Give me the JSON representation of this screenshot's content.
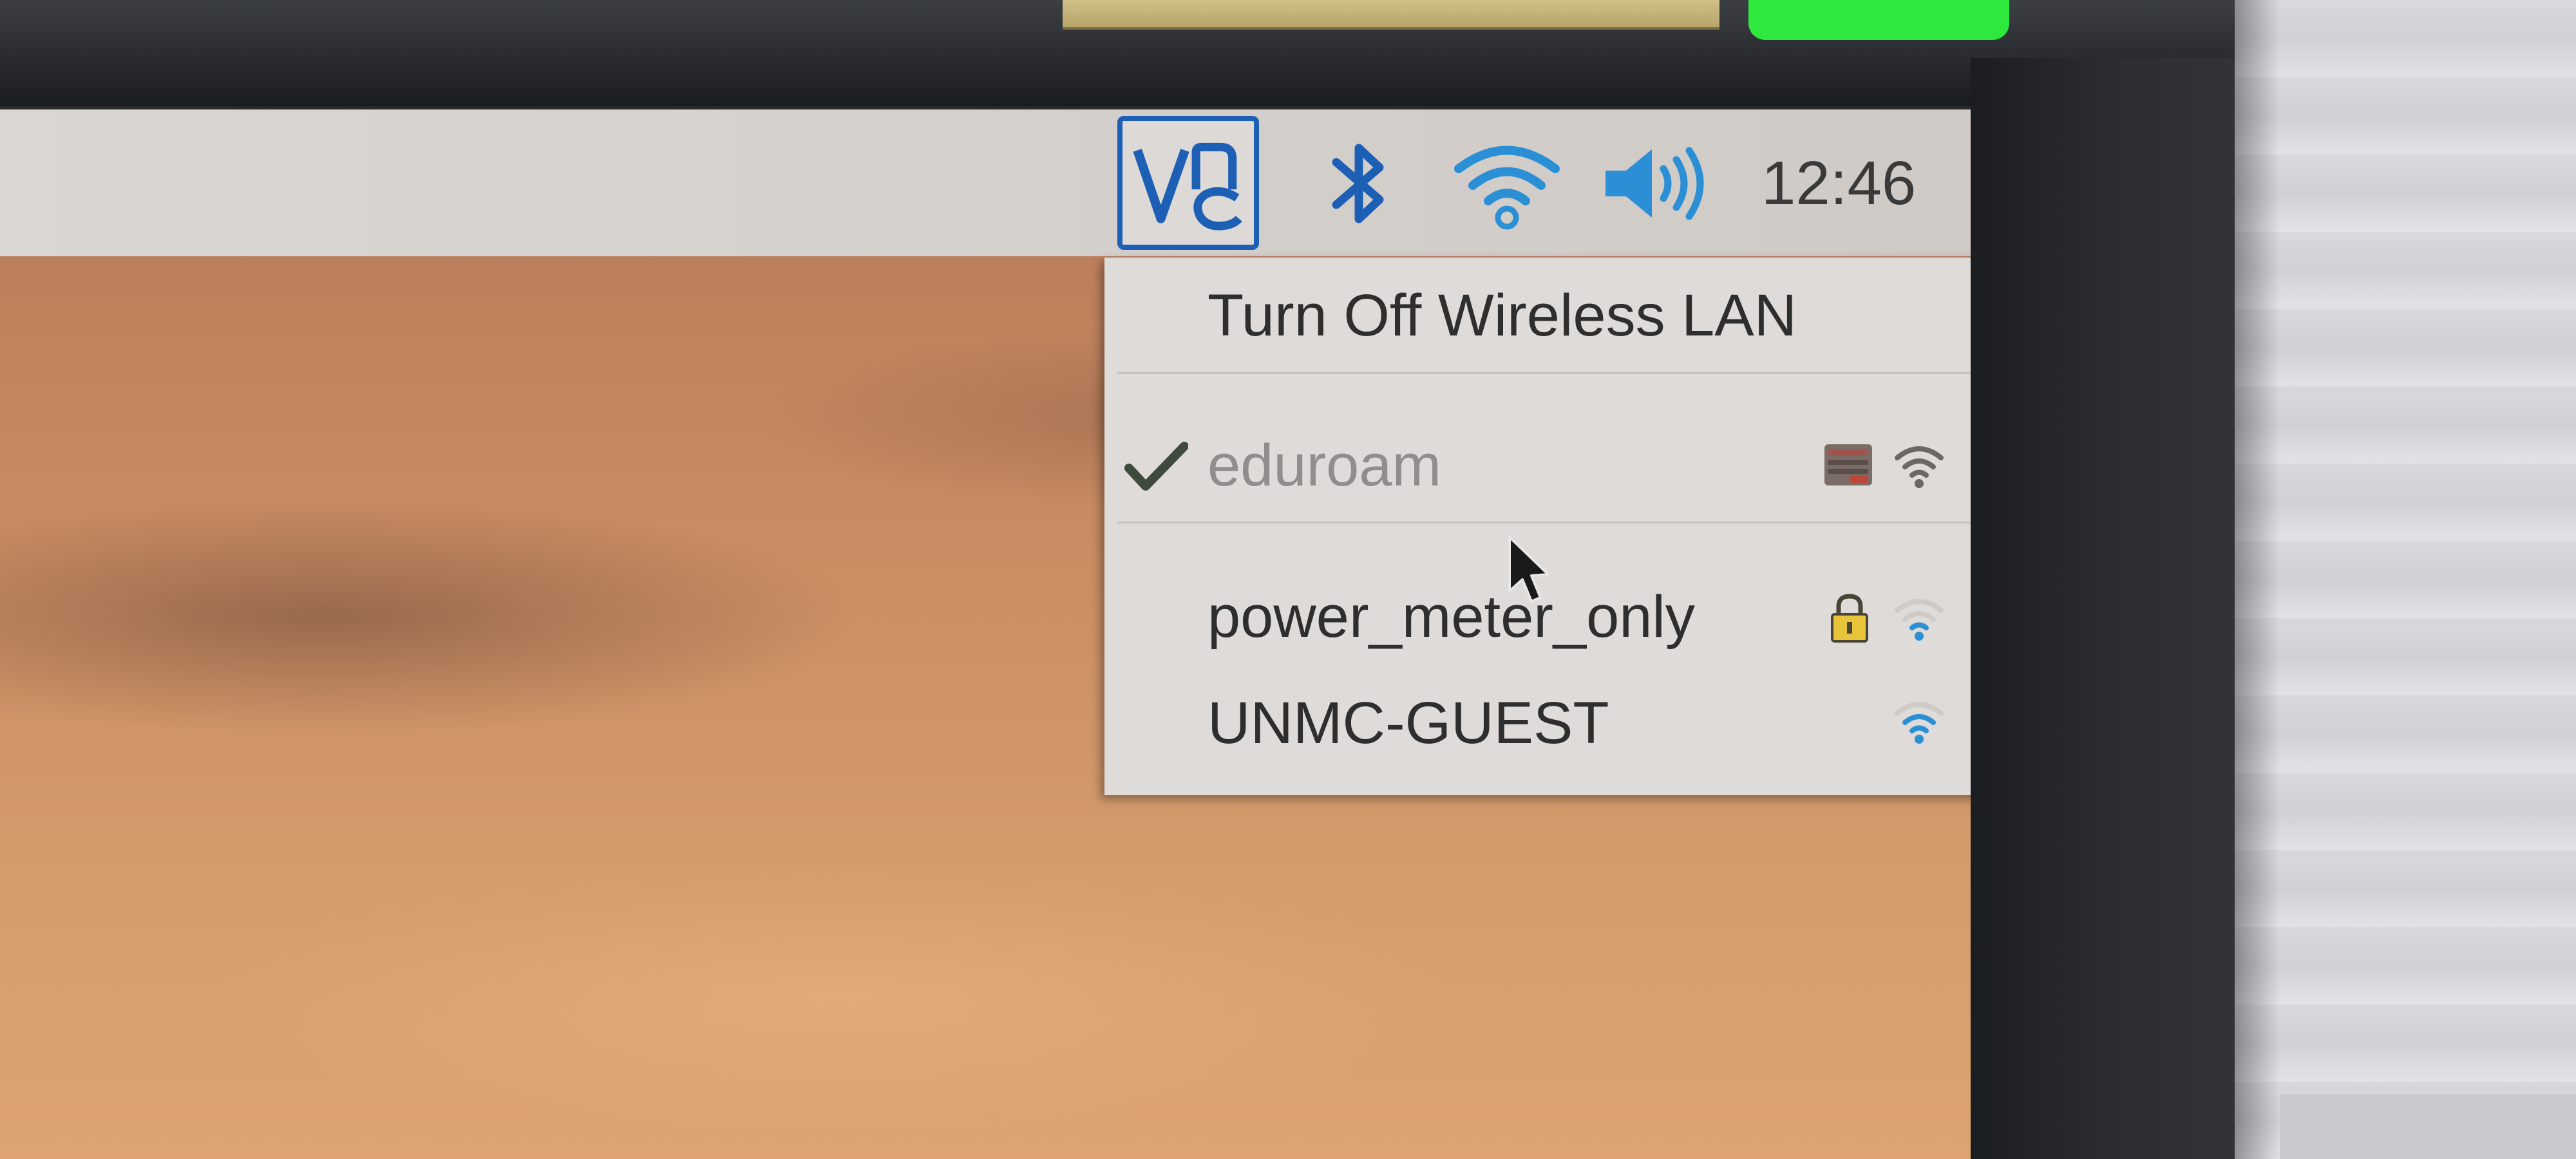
{
  "taskbar": {
    "clock": "12:46"
  },
  "tray_icons": [
    "vnc-icon",
    "bluetooth-icon",
    "wifi-icon",
    "volume-icon"
  ],
  "wifi_menu": {
    "toggle_label": "Turn Off Wireless LAN",
    "networks": [
      {
        "ssid": "eduroam",
        "connected": true,
        "secured_icon": "enterprise-security-icon",
        "signal_level": 4
      },
      {
        "ssid": "power_meter_only",
        "connected": false,
        "secured_icon": "lock-icon",
        "signal_level": 1
      },
      {
        "ssid": "UNMC-GUEST",
        "connected": false,
        "secured_icon": null,
        "signal_level": 3
      }
    ]
  },
  "colors": {
    "accent_blue": "#1e5fb6",
    "signal_blue": "#2b8fd6",
    "led_green": "#2ee83e",
    "taskbar_bg": "#d9d6d3",
    "menu_bg": "#dedbd8"
  }
}
